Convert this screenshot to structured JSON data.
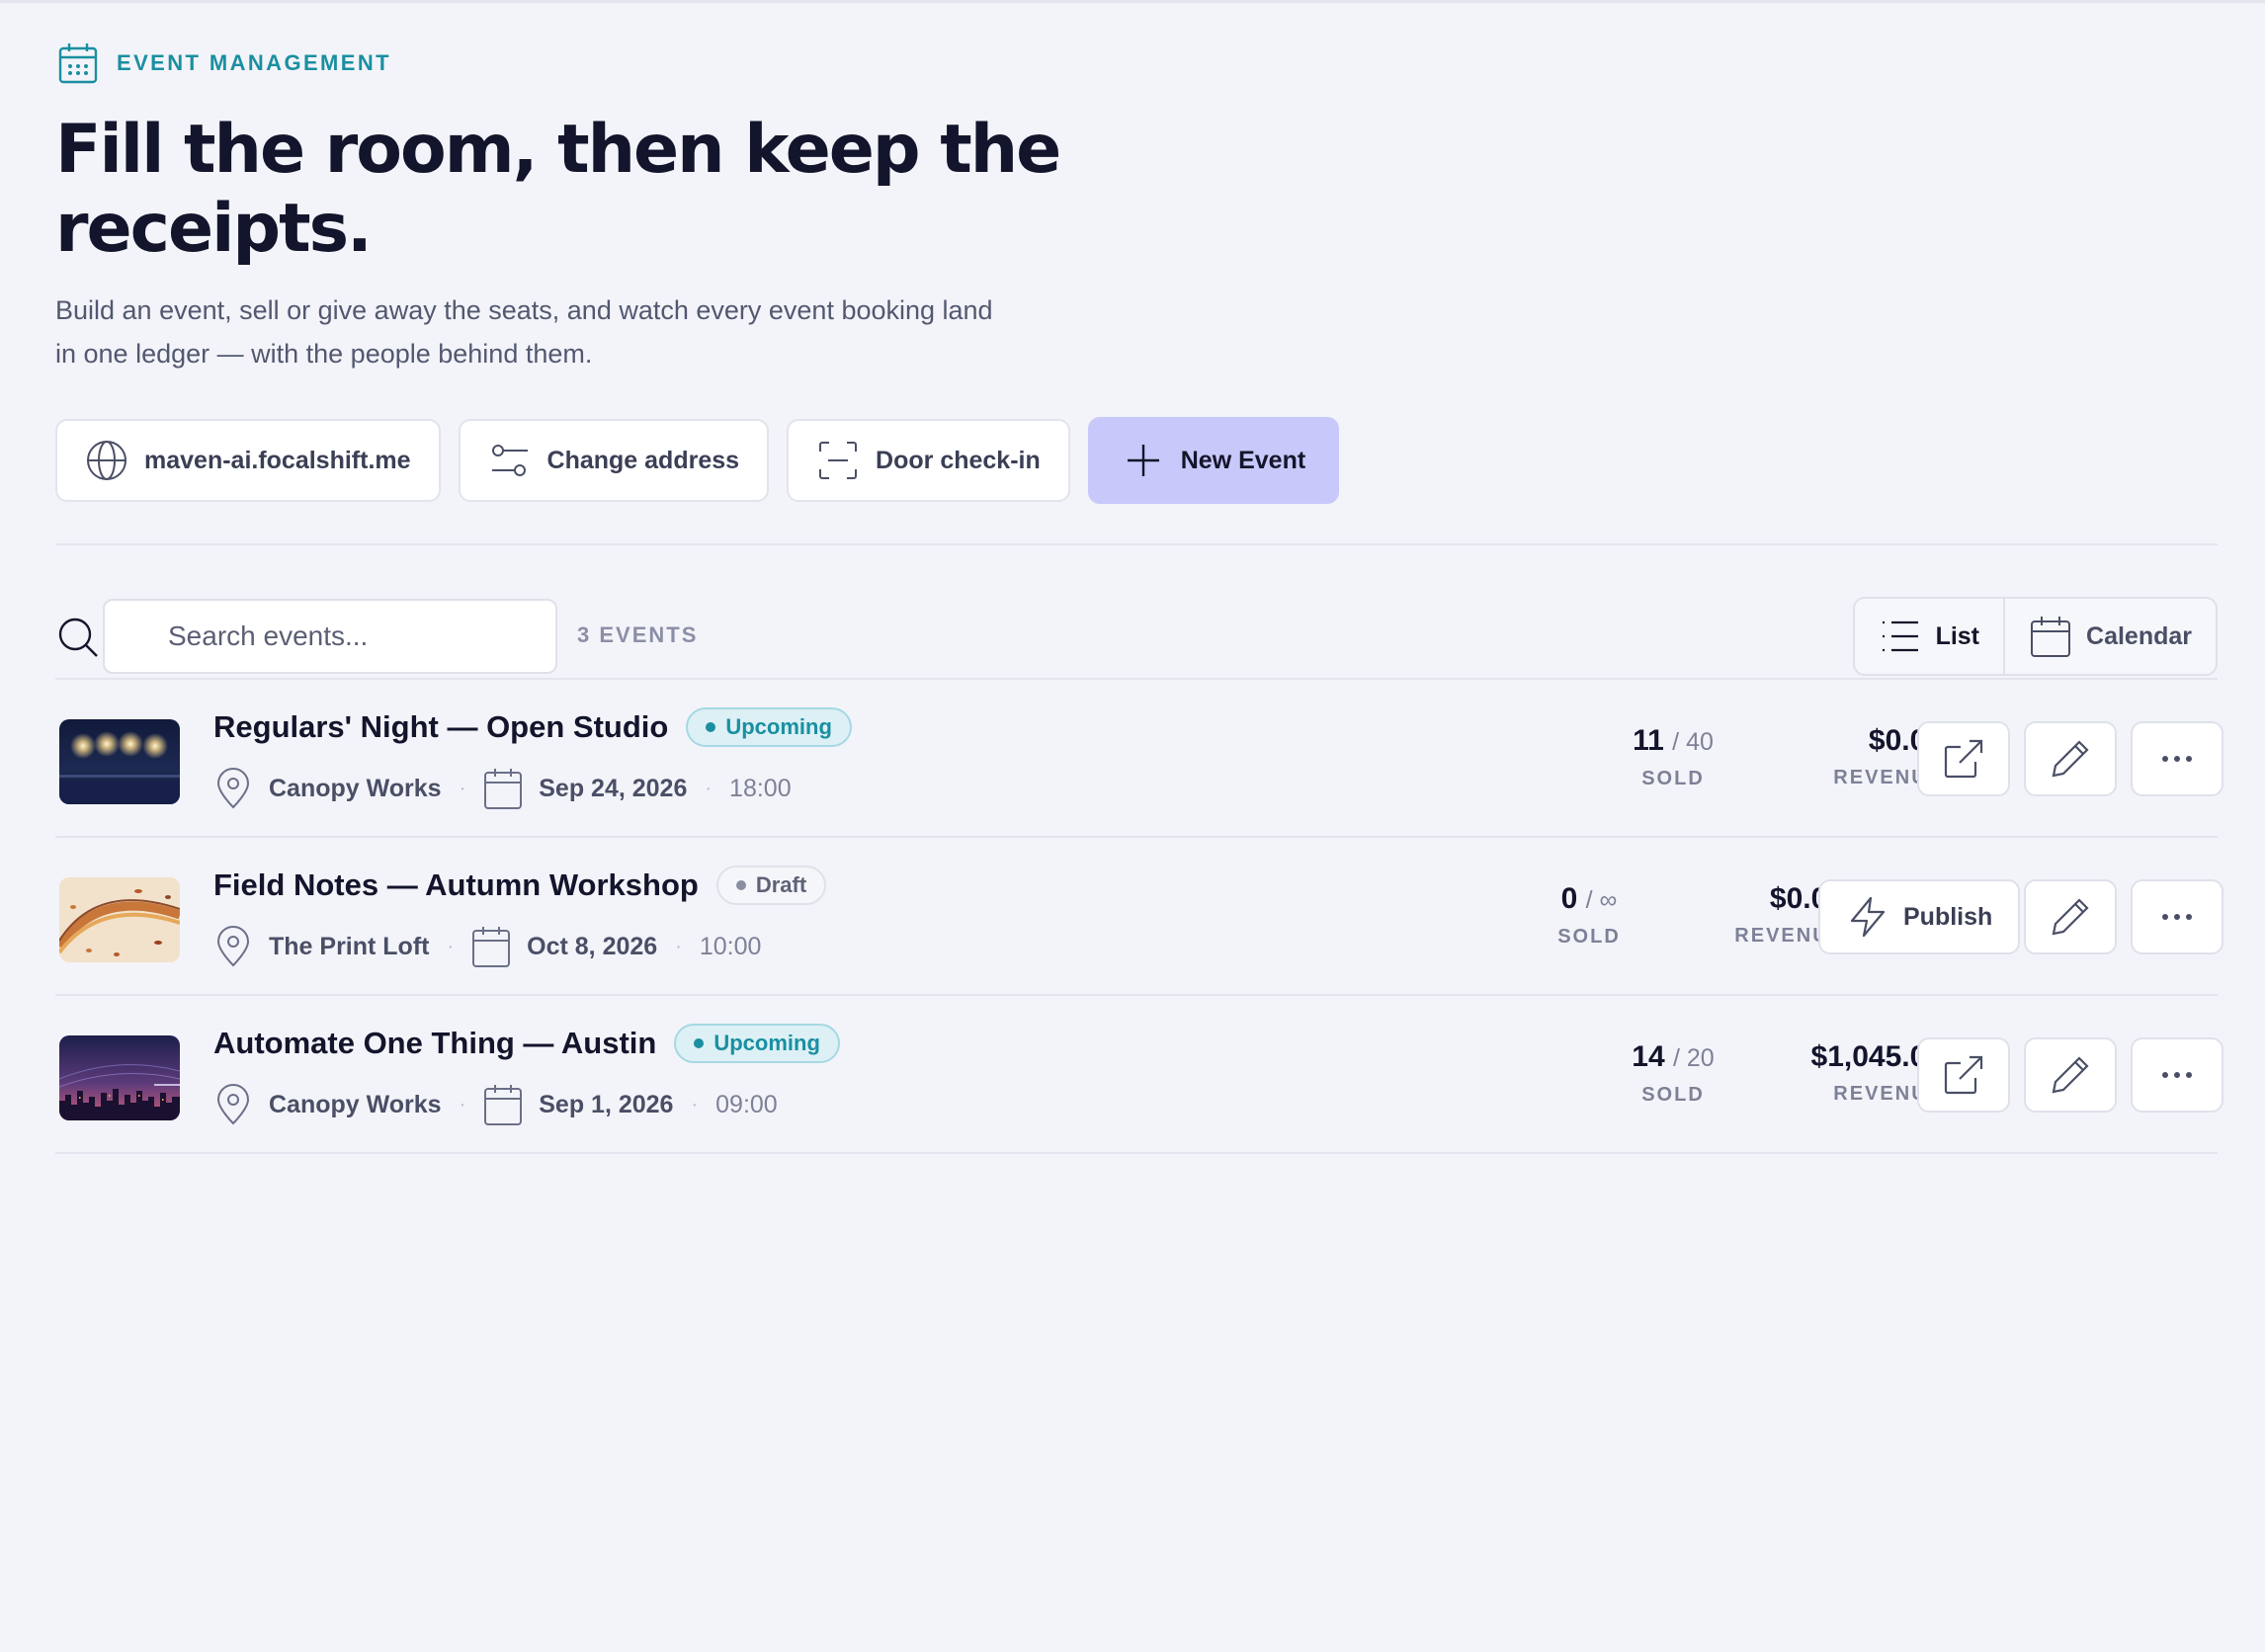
{
  "header": {
    "eyebrow": "EVENT MANAGEMENT",
    "headline_line1": "Fill the room, then keep the",
    "headline_line2": "receipts.",
    "subtitle_line1": "Build an event, sell or give away the seats, and watch every event booking land",
    "subtitle_line2": "in one ledger — with the people behind them."
  },
  "actions": {
    "domain_label": "maven-ai.focalshift.me",
    "change_address_label": "Change address",
    "door_checkin_label": "Door check-in",
    "new_event_label": "New Event"
  },
  "toolbar": {
    "search_placeholder": "Search events...",
    "count_label": "3 EVENTS",
    "view_list_label": "List",
    "view_calendar_label": "Calendar",
    "active_view": "List"
  },
  "events": [
    {
      "name": "Regulars' Night — Open Studio",
      "status": "Upcoming",
      "venue": "Canopy Works",
      "date": "Sep 24, 2026",
      "time": "18:00",
      "sold": "11",
      "capacity": "/ 40",
      "sold_label": "SOLD",
      "revenue": "$0.00",
      "revenue_label": "REVENUE",
      "thumbnail_icon": "stage-lights-image"
    },
    {
      "name": "Field Notes — Autumn Workshop",
      "status": "Draft",
      "venue": "The Print Loft",
      "date": "Oct 8, 2026",
      "time": "10:00",
      "sold": "0",
      "capacity": "/ ∞",
      "sold_label": "SOLD",
      "revenue": "$0.00",
      "revenue_label": "REVENUE",
      "publish_label": "Publish",
      "thumbnail_icon": "autumn-leaves-image"
    },
    {
      "name": "Automate One Thing — Austin",
      "status": "Upcoming",
      "venue": "Canopy Works",
      "date": "Sep 1, 2026",
      "time": "09:00",
      "sold": "14",
      "capacity": "/ 20",
      "sold_label": "SOLD",
      "revenue": "$1,045.00",
      "revenue_label": "REVENUE",
      "thumbnail_icon": "city-skyline-image"
    }
  ],
  "colors": {
    "accent": "#1a8fa1",
    "primary_button": "#c9c8fb",
    "background": "#f3f4f9",
    "heading": "#12152b"
  }
}
